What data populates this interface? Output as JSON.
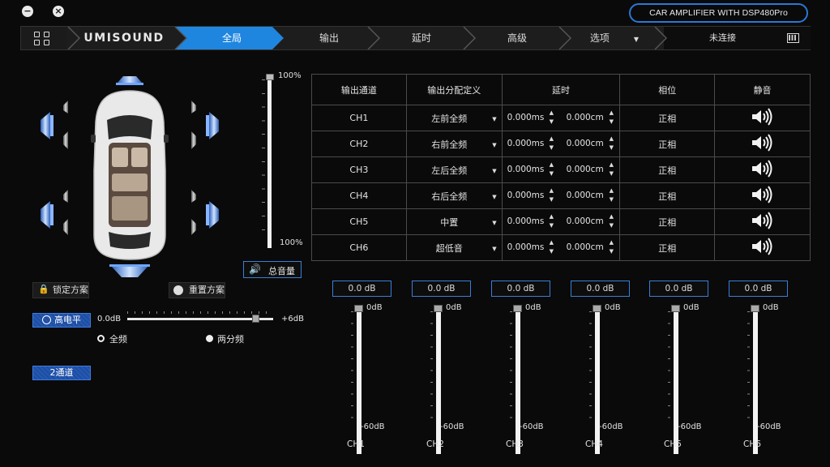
{
  "window": {
    "minimize": "−",
    "close": "×"
  },
  "product": "CAR AMPLIFIER WITH DSP480Pro",
  "nav": {
    "brand": "UMISOUND",
    "tabs": [
      "全局",
      "输出",
      "延时",
      "高级",
      "选项"
    ],
    "active_tab": "全局",
    "status": "未连接"
  },
  "master": {
    "top_label": "100%",
    "bottom_label": "100%",
    "button": "总音量"
  },
  "presets": {
    "lock": "锁定方案",
    "reset": "重置方案"
  },
  "high_level": {
    "button": "高电平",
    "min": "0.0dB",
    "max": "+6dB",
    "level": 0.9,
    "opt_full": "全频",
    "opt_two": "两分频",
    "channels_button": "2通道"
  },
  "table": {
    "headers": [
      "输出通道",
      "输出分配定义",
      "延时",
      "相位",
      "静音"
    ],
    "rows": [
      {
        "ch": "CH1",
        "assign": "左前全频",
        "ms": "0.000ms",
        "cm": "0.000cm",
        "phase": "正相"
      },
      {
        "ch": "CH2",
        "assign": "右前全频",
        "ms": "0.000ms",
        "cm": "0.000cm",
        "phase": "正相"
      },
      {
        "ch": "CH3",
        "assign": "左后全频",
        "ms": "0.000ms",
        "cm": "0.000cm",
        "phase": "正相"
      },
      {
        "ch": "CH4",
        "assign": "右后全频",
        "ms": "0.000ms",
        "cm": "0.000cm",
        "phase": "正相"
      },
      {
        "ch": "CH5",
        "assign": "中置",
        "ms": "0.000ms",
        "cm": "0.000cm",
        "phase": "正相"
      },
      {
        "ch": "CH6",
        "assign": "超低音",
        "ms": "0.000ms",
        "cm": "0.000cm",
        "phase": "正相"
      }
    ]
  },
  "faders": [
    {
      "name": "CH1",
      "value": "0.0 dB",
      "top": "0dB",
      "bottom": "-60dB"
    },
    {
      "name": "CH2",
      "value": "0.0 dB",
      "top": "0dB",
      "bottom": "-60dB"
    },
    {
      "name": "CH3",
      "value": "0.0 dB",
      "top": "0dB",
      "bottom": "-60dB"
    },
    {
      "name": "CH4",
      "value": "0.0 dB",
      "top": "0dB",
      "bottom": "-60dB"
    },
    {
      "name": "CH5",
      "value": "0.0 dB",
      "top": "0dB",
      "bottom": "-60dB"
    },
    {
      "name": "CH6",
      "value": "0.0 dB",
      "top": "0dB",
      "bottom": "-60dB"
    }
  ],
  "colors": {
    "accent": "#1f86e0",
    "button_blue": "#1b4ea7",
    "background": "#0a0a0a"
  }
}
